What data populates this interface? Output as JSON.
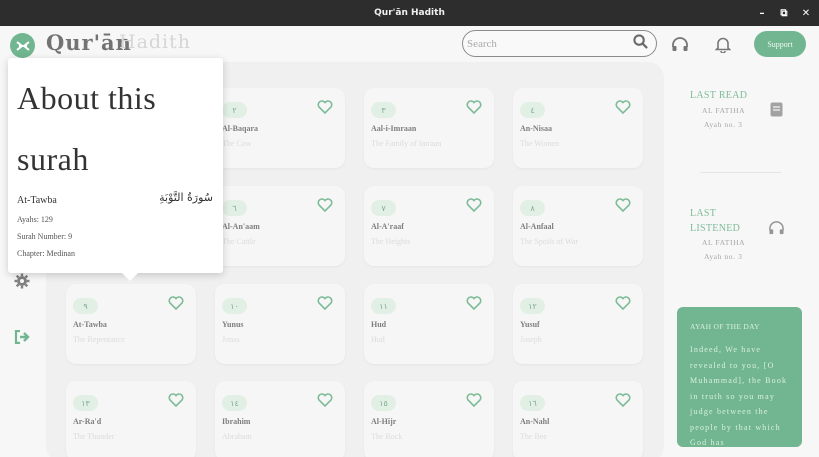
{
  "window": {
    "title": "Qur'ān Hadith",
    "controls": [
      "–",
      "⧉",
      "✕"
    ]
  },
  "header": {
    "logo_part1": "Qur'ān",
    "logo_part2": "Hadith",
    "search_placeholder": "Search",
    "support_label": "Support"
  },
  "surahs": [
    {
      "num": "٢",
      "name": "Al-Baqara",
      "meaning": "The Cow"
    },
    {
      "num": "٣",
      "name": "Aal-i-Imraan",
      "meaning": "The Family of Imraan"
    },
    {
      "num": "٤",
      "name": "An-Nisaa",
      "meaning": "The Women"
    },
    {
      "num": "٦",
      "name": "Al-An'aam",
      "meaning": "The Cattle"
    },
    {
      "num": "٧",
      "name": "Al-A'raaf",
      "meaning": "The Heights"
    },
    {
      "num": "٨",
      "name": "Al-Anfaal",
      "meaning": "The Spoils of War"
    },
    {
      "num": "٩",
      "name": "At-Tawba",
      "meaning": "The Repentance"
    },
    {
      "num": "١٠",
      "name": "Yunus",
      "meaning": "Jonas"
    },
    {
      "num": "١١",
      "name": "Hud",
      "meaning": "Hud"
    },
    {
      "num": "١٢",
      "name": "Yusuf",
      "meaning": "Joseph"
    },
    {
      "num": "١٣",
      "name": "Ar-Ra'd",
      "meaning": "The Thunder"
    },
    {
      "num": "١٤",
      "name": "Ibrahim",
      "meaning": "Abraham"
    },
    {
      "num": "١٥",
      "name": "Al-Hijr",
      "meaning": "The Rock"
    },
    {
      "num": "١٦",
      "name": "An-Nahl",
      "meaning": "The Bee"
    }
  ],
  "last_read": {
    "title": "LAST READ",
    "surah": "AL FATIHA",
    "ayah": "Ayah no. 3"
  },
  "last_listened": {
    "title_line1": "LAST",
    "title_line2": "LISTENED",
    "surah": "AL FATIHA",
    "ayah": "Ayah no. 3"
  },
  "ayah_of_day": {
    "title": "AYAH OF THE DAY",
    "text": "Indeed, We have revealed to you, [O Muhammad], the Book in truth so you may judge between the people by that which God has"
  },
  "popover": {
    "title": "About this surah",
    "name": "At-Tawba",
    "arabic": "سُورَةُ التَّوْبَةِ",
    "ayahs": "Ayahs: 129",
    "surah_number": "Surah Number: 9",
    "chapter": "Chapter: Medinan"
  },
  "colors": {
    "accent": "#1a8a4c",
    "accent_text": "#2f9457"
  }
}
